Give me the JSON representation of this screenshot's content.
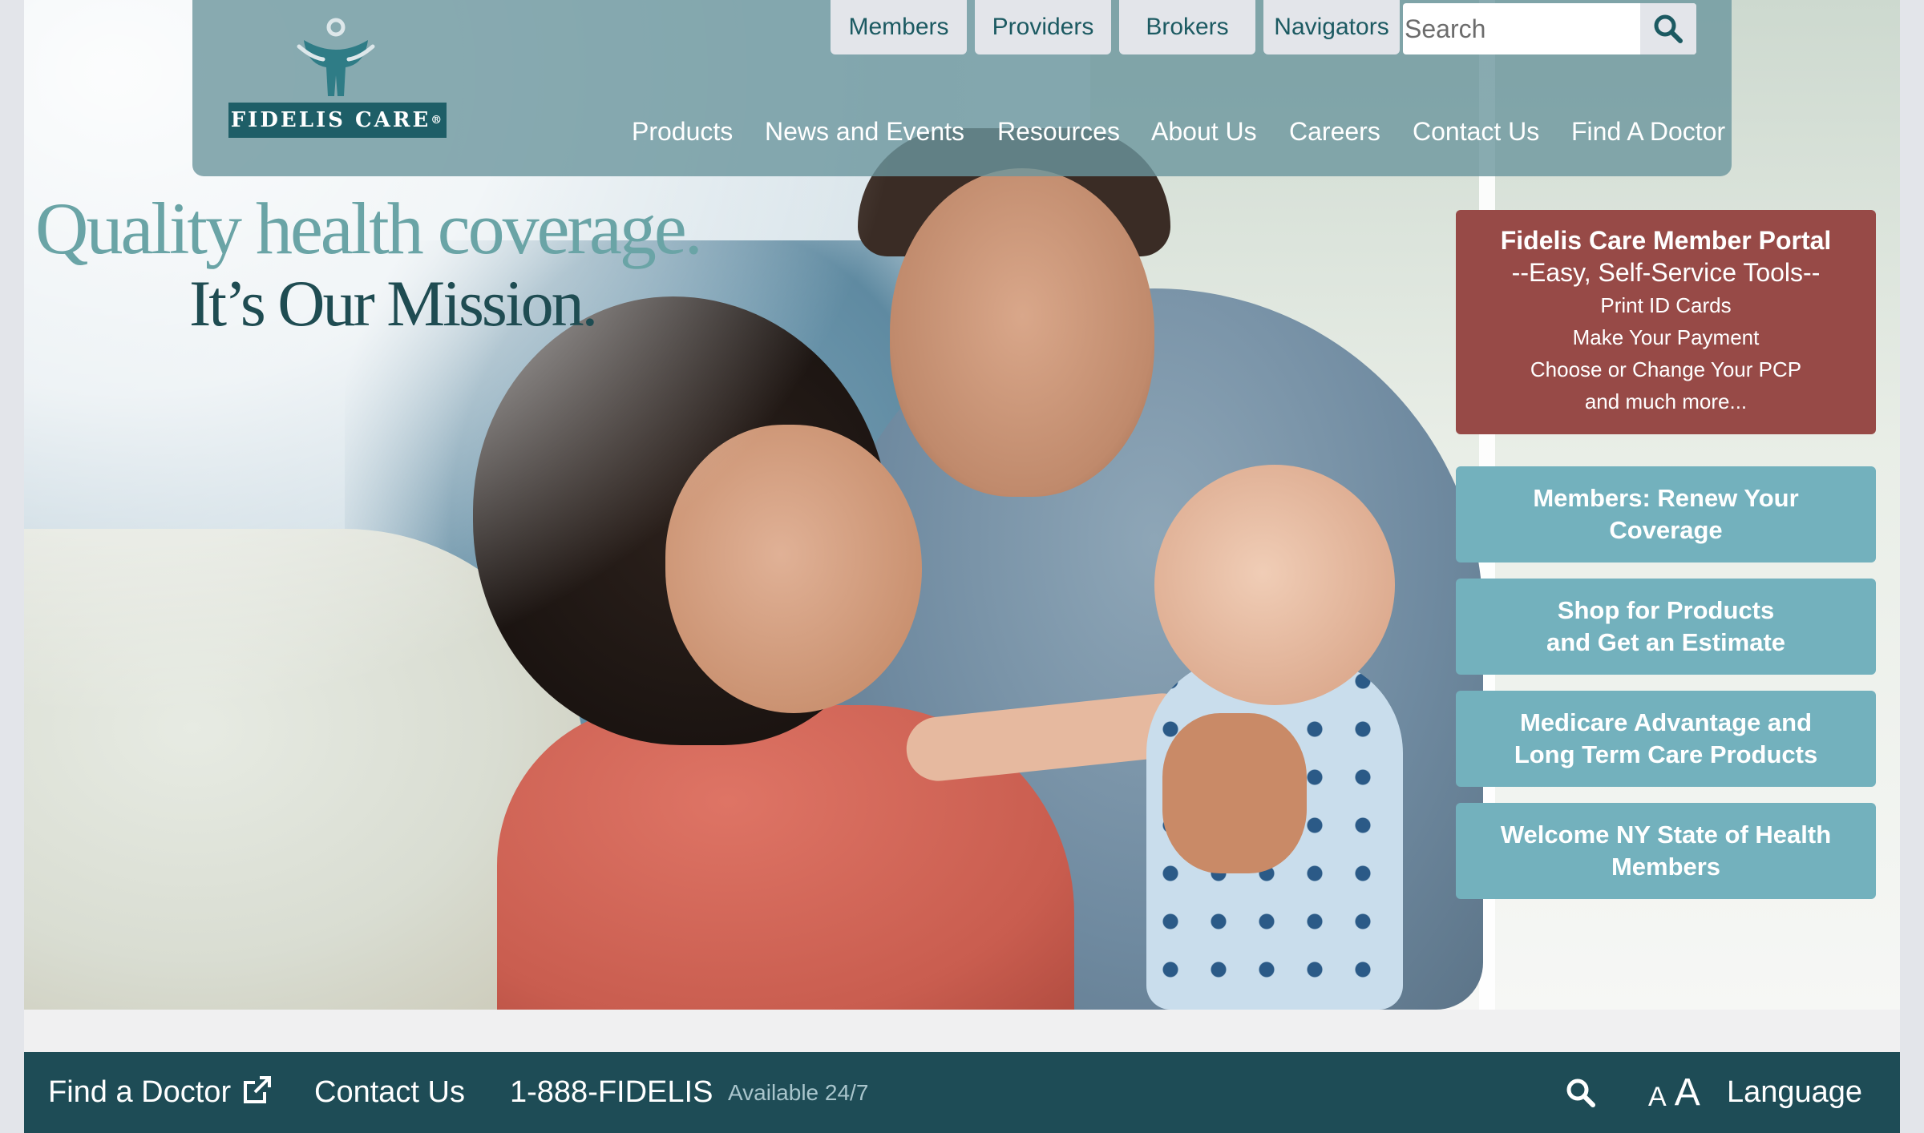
{
  "brand": {
    "name": "FIDELIS CARE",
    "trademark": "®"
  },
  "top_tabs": [
    "Members",
    "Providers",
    "Brokers",
    "Navigators"
  ],
  "search": {
    "placeholder": "Search",
    "icon": "search-icon"
  },
  "main_nav": [
    "Products",
    "News and Events",
    "Resources",
    "About Us",
    "Careers",
    "Contact Us",
    "Find A Doctor"
  ],
  "hero": {
    "tagline_line1": "Quality health coverage.",
    "tagline_line2": "It’s Our Mission."
  },
  "member_portal": {
    "title": "Fidelis Care Member Portal",
    "subtitle": "--Easy, Self-Service Tools--",
    "items": [
      "Print ID Cards",
      "Make Your Payment",
      "Choose or Change Your PCP",
      "and much more..."
    ]
  },
  "quick_links": [
    {
      "line1": "Members: Renew Your",
      "line2": "Coverage"
    },
    {
      "line1": "Shop for Products",
      "line2": "and Get an Estimate"
    },
    {
      "line1": "Medicare Advantage and",
      "line2": "Long Term Care Products"
    },
    {
      "line1": "Welcome NY State of Health",
      "line2": "Members"
    }
  ],
  "footer": {
    "find_doctor": "Find a Doctor",
    "find_doctor_icon": "external-link-icon",
    "contact": "Contact Us",
    "phone": "1-888-FIDELIS",
    "availability": "Available 24/7",
    "search_icon": "search-icon",
    "text_size_small": "A",
    "text_size_large": "A",
    "language": "Language"
  },
  "colors": {
    "header_bg": "#6c969e",
    "portal_bg": "#974a47",
    "quick_link_bg": "#73b1bd",
    "footer_bg": "#1e4c56",
    "tagline_light": "#6aa4a6",
    "tagline_dark": "#1f4c52"
  }
}
